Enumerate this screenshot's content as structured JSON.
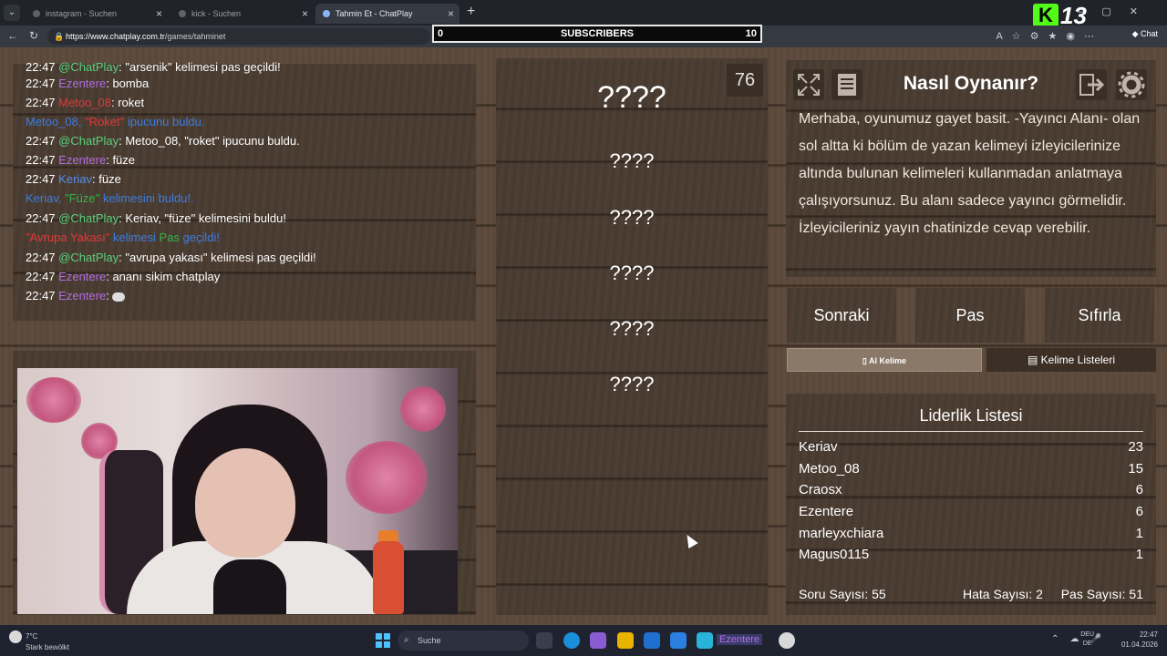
{
  "browser": {
    "tabs": [
      {
        "label": "instagram - Suchen",
        "active": false
      },
      {
        "label": "kick - Suchen",
        "active": false
      },
      {
        "label": "Tahmin Et - ChatPlay",
        "active": true
      }
    ],
    "url_host": "https://www.chatplay.com.tr",
    "url_path": "/games/tahminet",
    "copilot_label": "Chat"
  },
  "overlay": {
    "sub_left": "0",
    "sub_label": "SUBSCRIBERS",
    "sub_right": "10",
    "kick_letter": "K",
    "kick_number": "13"
  },
  "chat": {
    "lines": [
      {
        "time": "22:47",
        "user": "@ChatPlay",
        "user_class": "u-chatplay",
        "text": ": \"arsenik\" kelimesi pas geçildi!"
      },
      {
        "time": "22:47",
        "user": "Ezentere",
        "user_class": "u-ezentere",
        "text": ": bomba"
      },
      {
        "time": "22:47",
        "user": "Metoo_08",
        "user_class": "u-metoo",
        "text": ": roket"
      },
      {
        "system": true,
        "parts": [
          "Metoo_08, ",
          "\"Roket\"",
          " ipucunu buldu."
        ]
      },
      {
        "time": "22:47",
        "user": "@ChatPlay",
        "user_class": "u-chatplay",
        "text": ": Metoo_08, \"roket\" ipucunu buldu."
      },
      {
        "time": "22:47",
        "user": "Ezentere",
        "user_class": "u-ezentere",
        "text": ": füze"
      },
      {
        "time": "22:47",
        "user": "Keriav",
        "user_class": "u-keriav",
        "text": ": füze"
      },
      {
        "system": true,
        "parts": [
          "Keriav, ",
          "\"Füze\"",
          " kelimesini buldu!."
        ]
      },
      {
        "time": "22:47",
        "user": "@ChatPlay",
        "user_class": "u-chatplay",
        "text": ": Keriav, \"füze\" kelimesini buldu!"
      },
      {
        "system": true,
        "parts": [
          "\"Avrupa Yakası\"",
          " kelimesi ",
          "Pas",
          " geçildi!"
        ]
      },
      {
        "time": "22:47",
        "user": "@ChatPlay",
        "user_class": "u-chatplay",
        "text": ": \"avrupa yakası\" kelimesi pas geçildi!"
      },
      {
        "time": "22:47",
        "user": "Ezentere",
        "user_class": "u-ezentere",
        "text": ": ananı sikim chatplay"
      },
      {
        "time": "22:47",
        "user": "Ezentere",
        "user_class": "u-ezentere",
        "text": ": "
      }
    ]
  },
  "game": {
    "counter": "76",
    "main_word": "????",
    "hints": [
      "????",
      "????",
      "????",
      "????",
      "????"
    ]
  },
  "howto": {
    "title": "Nasıl Oynanır?",
    "text": "Merhaba, oyunumuz gayet basit. -Yayıncı Alanı- olan sol altta ki bölüm de yazan kelimeyi izleyicilerinize altında bulunan kelimeleri kullanmadan anlatmaya çalışıyorsunuz. Bu alanı sadece yayıncı görmelidir. İzleyicileriniz yayın chatinizde cevap verebilir."
  },
  "controls": {
    "next": "Sonraki",
    "pass": "Pas",
    "reset": "Sıfırla",
    "tab_word": "Al Kelime",
    "tab_lists": "Kelime Listeleri"
  },
  "leaderboard": {
    "title": "Liderlik Listesi",
    "rows": [
      {
        "name": "Keriav",
        "score": "23"
      },
      {
        "name": "Metoo_08",
        "score": "15"
      },
      {
        "name": "Craosx",
        "score": "6"
      },
      {
        "name": "Ezentere",
        "score": "6"
      },
      {
        "name": "marleyxchiara",
        "score": "1"
      },
      {
        "name": "Magus0115",
        "score": "1"
      }
    ],
    "questions": "Soru Sayısı: 55",
    "errors": "Hata Sayısı: 2",
    "passes": "Pas Sayısı: 51"
  },
  "taskbar": {
    "weather_temp": "7°C",
    "weather_desc": "Stark bewölkt",
    "search": "Suche",
    "active_app_label": "Ezentere",
    "lang_1": "DEU",
    "lang_2": "DE",
    "time": "22:47",
    "date": "01.04.2026"
  }
}
